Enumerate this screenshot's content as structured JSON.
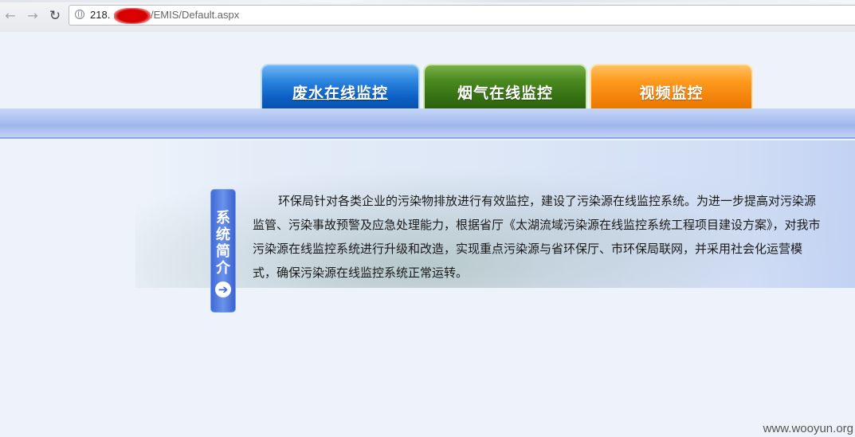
{
  "browser": {
    "url_host": "218.",
    "url_path": "/EMIS/Default.aspx",
    "back_glyph": "←",
    "forward_glyph": "→",
    "reload_glyph": "↻",
    "back_icon": "arrow-left-icon",
    "forward_icon": "arrow-right-icon",
    "reload_icon": "reload-icon",
    "site_icon": "globe-icon"
  },
  "nav_tabs": [
    {
      "label": "废水在线监控",
      "color": "#1a6fd1"
    },
    {
      "label": "烟气在线监控",
      "color": "#46821a"
    },
    {
      "label": "视频监控",
      "color": "#f58a10"
    }
  ],
  "intro": {
    "tag_label": "系统简介",
    "tag_arrow": "➔",
    "tag_arrow_icon": "arrow-circle-right-icon",
    "text": "环保局针对各类企业的污染物排放进行有效监控，建设了污染源在线监控系统。为进一步提高对污染源监管、污染事故预警及应急处理能力，根据省厅《太湖流域污染源在线监控系统工程项目建设方案》，对我市污染源在线监控系统进行升级和改造，实现重点污染源与省环保厅、市环保局联网，并采用社会化运营模式，确保污染源在线监控系统正常运转。"
  },
  "watermark": "www.wooyun.org"
}
